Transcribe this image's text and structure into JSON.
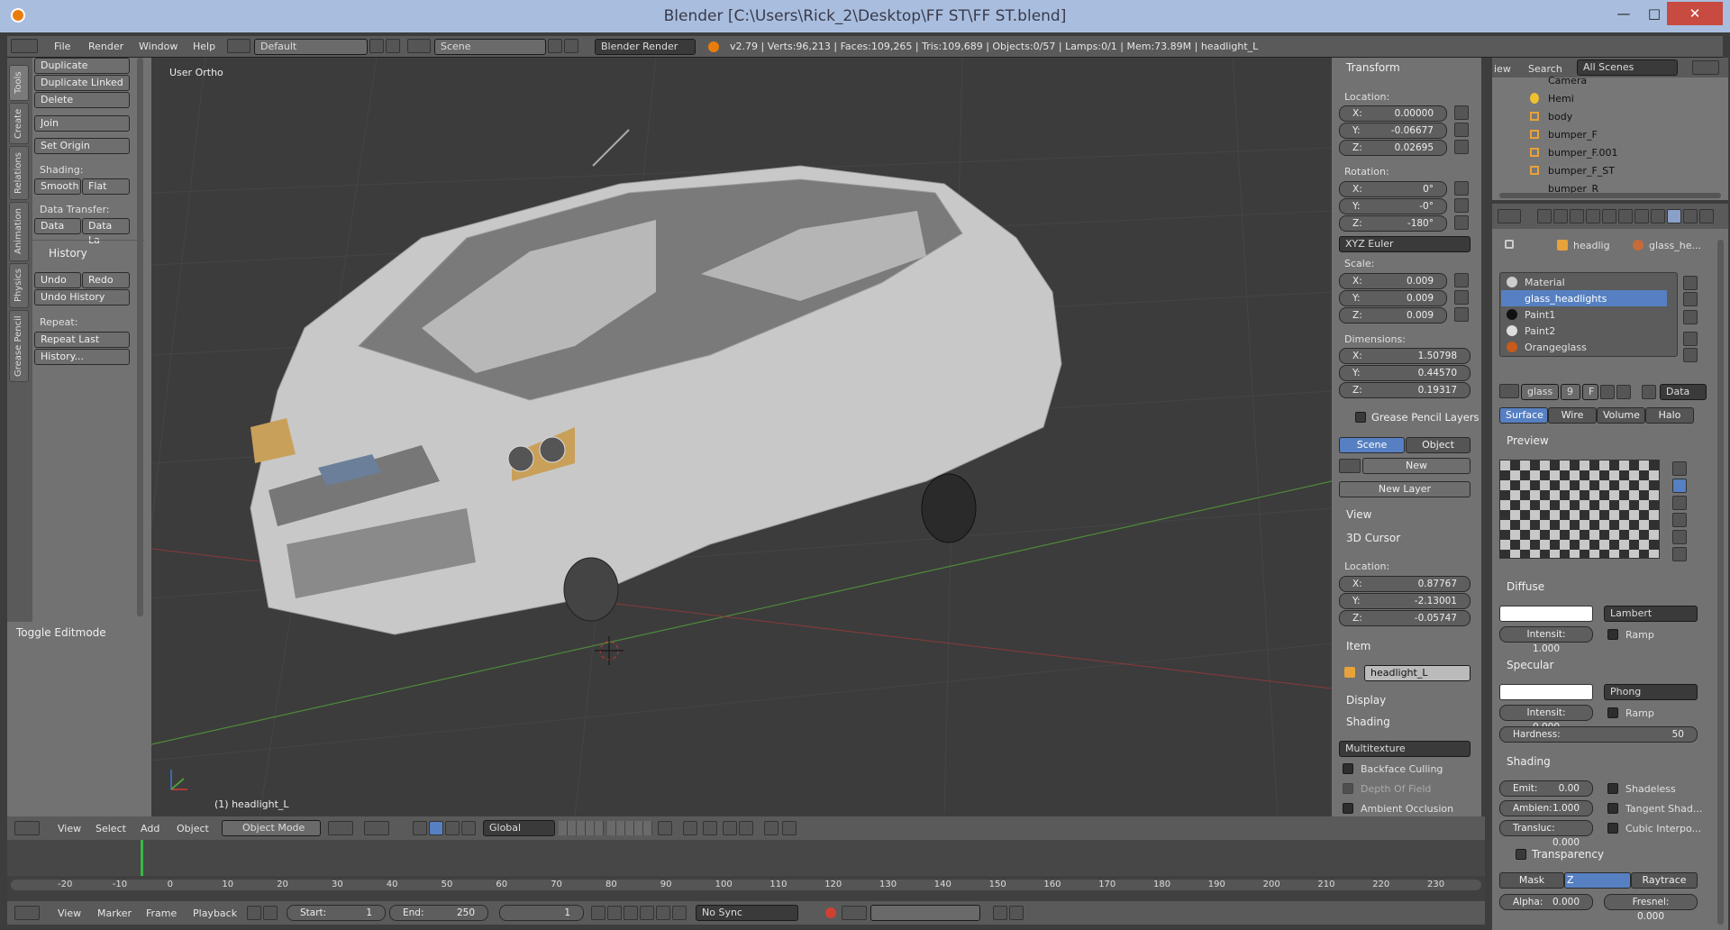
{
  "window": {
    "title": "Blender [C:\\Users\\Rick_2\\Desktop\\FF ST\\FF ST.blend]"
  },
  "menu": {
    "file": "File",
    "render": "Render",
    "window": "Window",
    "help": "Help",
    "layout": "Default",
    "scene": "Scene",
    "engine": "Blender Render",
    "stats": "v2.79 | Verts:96,213 | Faces:109,265 | Tris:109,689 | Objects:0/57 | Lamps:0/1 | Mem:73.89M | headlight_L"
  },
  "tools": {
    "tabs": [
      "Tools",
      "Create",
      "Relations",
      "Animation",
      "Physics",
      "Grease Pencil"
    ],
    "duplicate": "Duplicate",
    "duplicate_linked": "Duplicate Linked",
    "delete": "Delete",
    "join": "Join",
    "set_origin": "Set Origin",
    "shading_label": "Shading:",
    "smooth": "Smooth",
    "flat": "Flat",
    "data_transfer_label": "Data Transfer:",
    "data": "Data",
    "data_la": "Data La",
    "history_header": "History",
    "undo": "Undo",
    "redo": "Redo",
    "undo_history": "Undo History",
    "repeat_label": "Repeat:",
    "repeat_last": "Repeat Last",
    "history_btn": "History...",
    "toggle_editmode": "Toggle Editmode"
  },
  "viewport": {
    "view_name": "User Ortho",
    "object_label": "(1) headlight_L"
  },
  "npanel": {
    "transform": "Transform",
    "location": "Location:",
    "rotation": "Rotation:",
    "scale": "Scale:",
    "dimensions": "Dimensions:",
    "loc": {
      "x": "0.00000",
      "y": "-0.06677",
      "z": "0.02695"
    },
    "rot": {
      "x": "0°",
      "y": "-0°",
      "z": "-180°"
    },
    "rot_mode": "XYZ Euler",
    "scl": {
      "x": "0.009",
      "y": "0.009",
      "z": "0.009"
    },
    "dim": {
      "x": "1.50798",
      "y": "0.44570",
      "z": "0.19317"
    },
    "axis": {
      "x": "X:",
      "y": "Y:",
      "z": "Z:"
    },
    "gp_layers": "Grease Pencil Layers",
    "scene_btn": "Scene",
    "object_btn": "Object",
    "new_btn": "New",
    "new_layer": "New Layer",
    "view": "View",
    "cursor": "3D Cursor",
    "cursor_loc": "Location:",
    "cur": {
      "x": "0.87767",
      "y": "-2.13001",
      "z": "-0.05747"
    },
    "item": "Item",
    "item_name": "headlight_L",
    "display": "Display",
    "shading": "Shading",
    "shading_mode": "Multitexture",
    "backface": "Backface Culling",
    "dof": "Depth Of Field",
    "ao": "Ambient Occlusion"
  },
  "outliner": {
    "view": "iew",
    "search": "Search",
    "scope": "All Scenes",
    "rows": [
      "Camera",
      "Hemi",
      "body",
      "bumper_F",
      "bumper_F.001",
      "bumper_F_ST",
      "bumper_R"
    ]
  },
  "props": {
    "crumb_obj": "headlig",
    "crumb_mat": "glass_he...",
    "materials": [
      "Material",
      "glass_headlights",
      "Paint1",
      "Paint2",
      "Orangeglass"
    ],
    "mat_name": "glass",
    "users": "9",
    "fake": "F",
    "data": "Data",
    "tabs": [
      "Surface",
      "Wire",
      "Volume",
      "Halo"
    ],
    "preview": "Preview",
    "diffuse": "Diffuse",
    "diffuse_shader": "Lambert",
    "diffuse_int": "Intensit: 1.000",
    "ramp": "Ramp",
    "specular": "Specular",
    "spec_shader": "Phong",
    "spec_int": "Intensit: 0.000",
    "hardness_l": "Hardness:",
    "hardness_v": "50",
    "shading": "Shading",
    "emit": "Emit:",
    "emit_v": "0.00",
    "shadeless": "Shadeless",
    "ambient": "Ambien:",
    "ambient_v": "1.000",
    "tangent": "Tangent Shad...",
    "transluc": "Transluc:",
    "transluc_v": "0.000",
    "cubic": "Cubic Interpo...",
    "transparency": "Transparency",
    "mask": "Mask",
    "ztransp": "Z Transpare...",
    "raytrace": "Raytrace",
    "alpha": "Alpha:",
    "alpha_v": "0.000",
    "fresnel": "Fresnel: 0.000"
  },
  "vphdr": {
    "view": "View",
    "select": "Select",
    "add": "Add",
    "object": "Object",
    "mode": "Object Mode",
    "orientation": "Global"
  },
  "timeline": {
    "ticks": [
      "-20",
      "-10",
      "0",
      "10",
      "20",
      "30",
      "40",
      "50",
      "60",
      "70",
      "80",
      "90",
      "100",
      "110",
      "120",
      "130",
      "140",
      "150",
      "160",
      "170",
      "180",
      "190",
      "200",
      "210",
      "220",
      "230"
    ],
    "view": "View",
    "marker": "Marker",
    "frame": "Frame",
    "playback": "Playback",
    "start_l": "Start:",
    "start_v": "1",
    "end_l": "End:",
    "end_v": "250",
    "current": "1",
    "sync": "No Sync"
  }
}
